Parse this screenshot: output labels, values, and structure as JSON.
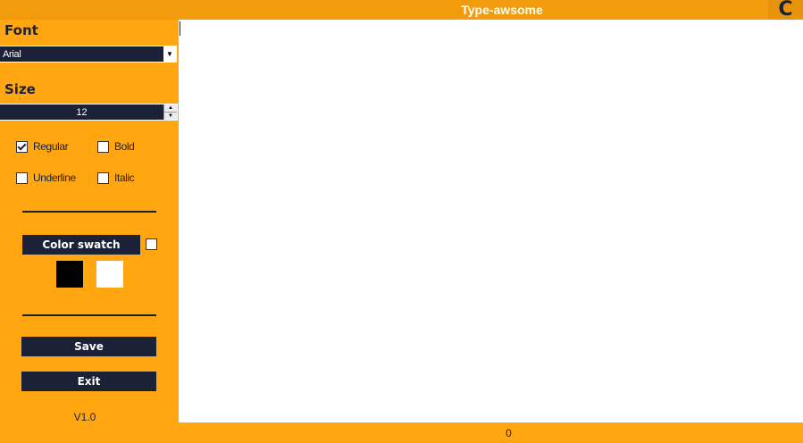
{
  "window": {
    "title": "Type-awsome",
    "close_label": "C"
  },
  "sidebar": {
    "font_heading": "Font",
    "font_value": "Arial",
    "size_heading": "Size",
    "size_value": "12",
    "styles": {
      "regular": {
        "label": "Regular",
        "checked": true
      },
      "bold": {
        "label": "Bold",
        "checked": false
      },
      "underline": {
        "label": "Underline",
        "checked": false
      },
      "italic": {
        "label": "Italic",
        "checked": false
      }
    },
    "color_swatch_label": "Color swatch",
    "swatch_colors": {
      "foreground": "#000000",
      "background": "#FFFFFF"
    },
    "save_label": "Save",
    "exit_label": "Exit",
    "version": "V1.0"
  },
  "editor": {
    "text": ""
  },
  "status": {
    "char_count": "0"
  },
  "colors": {
    "accent": "#FFA611",
    "dark": "#1B2237"
  }
}
